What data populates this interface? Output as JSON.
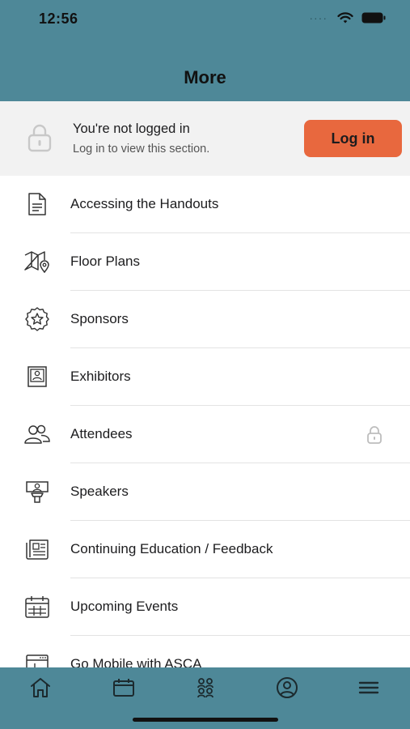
{
  "status_bar": {
    "time": "12:56"
  },
  "header": {
    "title": "More"
  },
  "login_banner": {
    "title": "You're not logged in",
    "subtitle": "Log in to view this section.",
    "button_label": "Log in"
  },
  "menu": {
    "items": [
      {
        "label": "Accessing the Handouts",
        "icon": "document-icon",
        "locked": false
      },
      {
        "label": "Floor Plans",
        "icon": "map-pin-icon",
        "locked": false
      },
      {
        "label": "Sponsors",
        "icon": "star-badge-icon",
        "locked": false
      },
      {
        "label": "Exhibitors",
        "icon": "exhibitor-booth-icon",
        "locked": false
      },
      {
        "label": "Attendees",
        "icon": "people-icon",
        "locked": true
      },
      {
        "label": "Speakers",
        "icon": "podium-speaker-icon",
        "locked": false
      },
      {
        "label": "Continuing Education / Feedback",
        "icon": "newspaper-icon",
        "locked": false
      },
      {
        "label": "Upcoming Events",
        "icon": "calendar-grid-icon",
        "locked": false
      },
      {
        "label": "Go Mobile with ASCA",
        "icon": "browser-window-icon",
        "locked": false
      }
    ]
  },
  "tab_bar": {
    "tabs": [
      "home-icon",
      "calendar-icon",
      "group-icon",
      "profile-icon",
      "menu-icon"
    ]
  },
  "colors": {
    "header_bg": "#4e8898",
    "accent_button": "#e8683e",
    "banner_bg": "#f2f2f2"
  }
}
